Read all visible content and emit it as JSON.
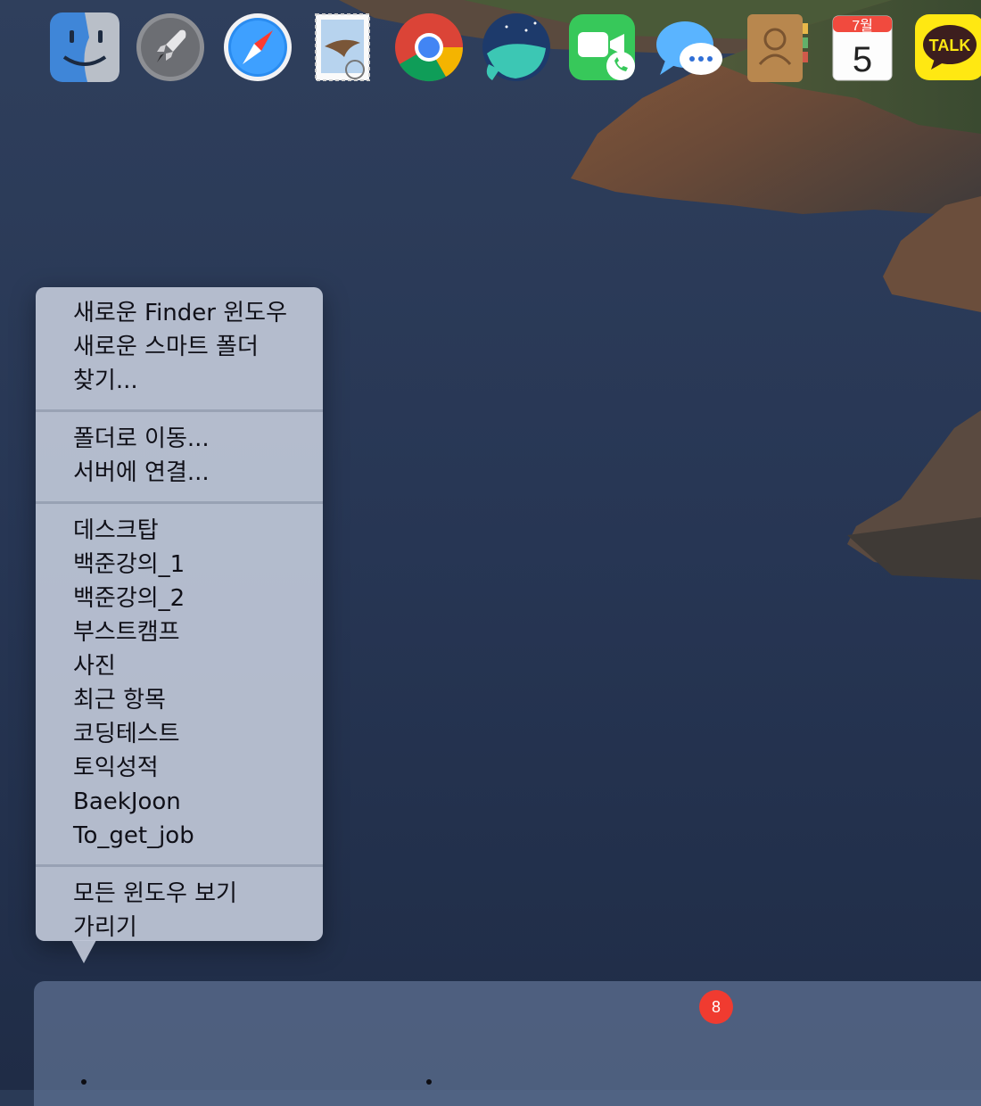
{
  "menu": {
    "group1": [
      "새로운 Finder 윈도우",
      "새로운 스마트 폴더",
      "찾기..."
    ],
    "group2": [
      "폴더로 이동...",
      "서버에 연결..."
    ],
    "group3": [
      "데스크탑",
      "백준강의_1",
      "백준강의_2",
      "부스트캠프",
      "사진",
      "최근 항목",
      "코딩테스트",
      "토익성적",
      "BaekJoon",
      "To_get_job"
    ],
    "group4": [
      "모든 윈도우 보기",
      "가리기"
    ]
  },
  "dock": {
    "apps": [
      {
        "icon": "finder-icon",
        "running": true
      },
      {
        "icon": "launchpad-icon",
        "running": false
      },
      {
        "icon": "safari-icon",
        "running": false
      },
      {
        "icon": "mail-icon",
        "running": false
      },
      {
        "icon": "chrome-icon",
        "running": true
      },
      {
        "icon": "whale-icon",
        "running": false
      },
      {
        "icon": "facetime-icon",
        "running": false
      },
      {
        "icon": "messages-icon",
        "running": false
      },
      {
        "icon": "contacts-icon",
        "running": false
      },
      {
        "icon": "calendar-icon",
        "running": false
      },
      {
        "icon": "kakaotalk-icon",
        "running": false
      }
    ],
    "messages_badge": "8",
    "calendar_month": "7월",
    "calendar_day": "5",
    "kakaotalk_label": "TALK"
  },
  "colors": {
    "menu_bg": "#bec6d6",
    "badge": "#f03b30",
    "kakao_yellow": "#ffe812"
  }
}
